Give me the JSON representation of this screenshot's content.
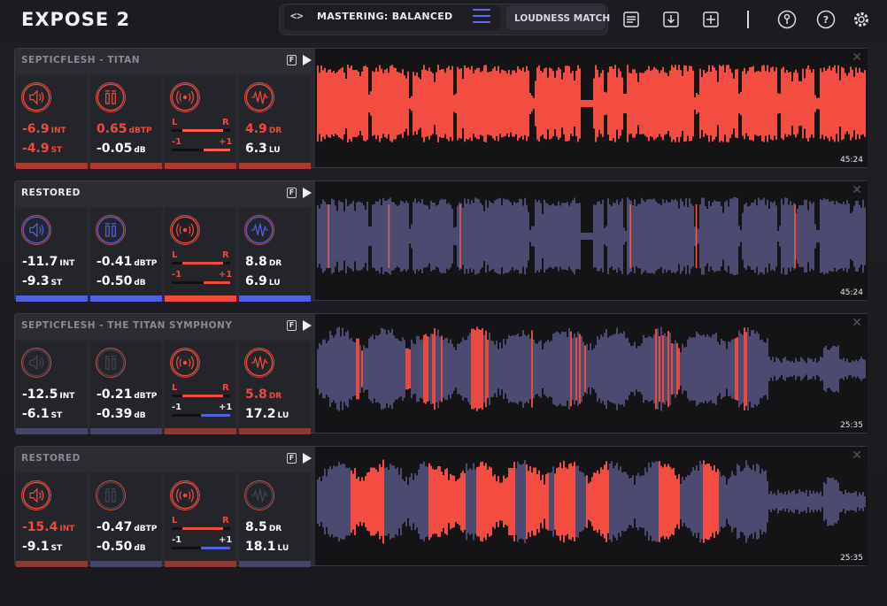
{
  "app": {
    "title": "EXPOSE 2",
    "preset_label": "MASTERING: BALANCED",
    "loudness_match_label": "LOUDNESS MATCH"
  },
  "colors": {
    "red": "#f04a3e",
    "blue": "#5060e0",
    "wave_gray": "#4b4b72",
    "dim_text": "#8a8a96"
  },
  "header_icons": [
    "code-brackets-icon",
    "menu-icon",
    "list-icon",
    "download-icon",
    "add-icon",
    "key-icon",
    "help-icon",
    "settings-icon"
  ],
  "tracks": [
    {
      "name": "SEPTICFLESH - TITAN",
      "f_label": "F",
      "duration": "45:24",
      "close_symbol": "✕",
      "int": "-6.9",
      "int_unit": "INT",
      "st": "-4.9",
      "st_unit": "ST",
      "dbtp": "0.65",
      "dbtp_unit": "dBTP",
      "db": "-0.05",
      "db_unit": "dB",
      "l_label": "L",
      "r_label": "R",
      "minus_label": "-1",
      "plus_label": "+1",
      "dr": "4.9",
      "dr_unit": "DR",
      "lu": "6.3",
      "lu_unit": "LU"
    },
    {
      "name": "RESTORED",
      "f_label": "F",
      "duration": "45:24",
      "close_symbol": "✕",
      "int": "-11.7",
      "int_unit": "INT",
      "st": "-9.3",
      "st_unit": "ST",
      "dbtp": "-0.41",
      "dbtp_unit": "dBTP",
      "db": "-0.50",
      "db_unit": "dB",
      "l_label": "L",
      "r_label": "R",
      "minus_label": "-1",
      "plus_label": "+1",
      "dr": "8.8",
      "dr_unit": "DR",
      "lu": "6.9",
      "lu_unit": "LU"
    },
    {
      "name": "SEPTICFLESH - THE TITAN SYMPHONY",
      "f_label": "F",
      "duration": "25:35",
      "close_symbol": "✕",
      "int": "-12.5",
      "int_unit": "INT",
      "st": "-6.1",
      "st_unit": "ST",
      "dbtp": "-0.21",
      "dbtp_unit": "dBTP",
      "db": "-0.39",
      "db_unit": "dB",
      "l_label": "L",
      "r_label": "R",
      "minus_label": "-1",
      "plus_label": "+1",
      "dr": "5.8",
      "dr_unit": "DR",
      "lu": "17.2",
      "lu_unit": "LU"
    },
    {
      "name": "RESTORED",
      "f_label": "F",
      "duration": "25:35",
      "close_symbol": "✕",
      "int": "-15.4",
      "int_unit": "INT",
      "st": "-9.1",
      "st_unit": "ST",
      "dbtp": "-0.47",
      "dbtp_unit": "dBTP",
      "db": "-0.50",
      "db_unit": "dB",
      "l_label": "L",
      "r_label": "R",
      "minus_label": "-1",
      "plus_label": "+1",
      "dr": "8.5",
      "dr_unit": "DR",
      "lu": "18.1",
      "lu_unit": "LU"
    }
  ]
}
